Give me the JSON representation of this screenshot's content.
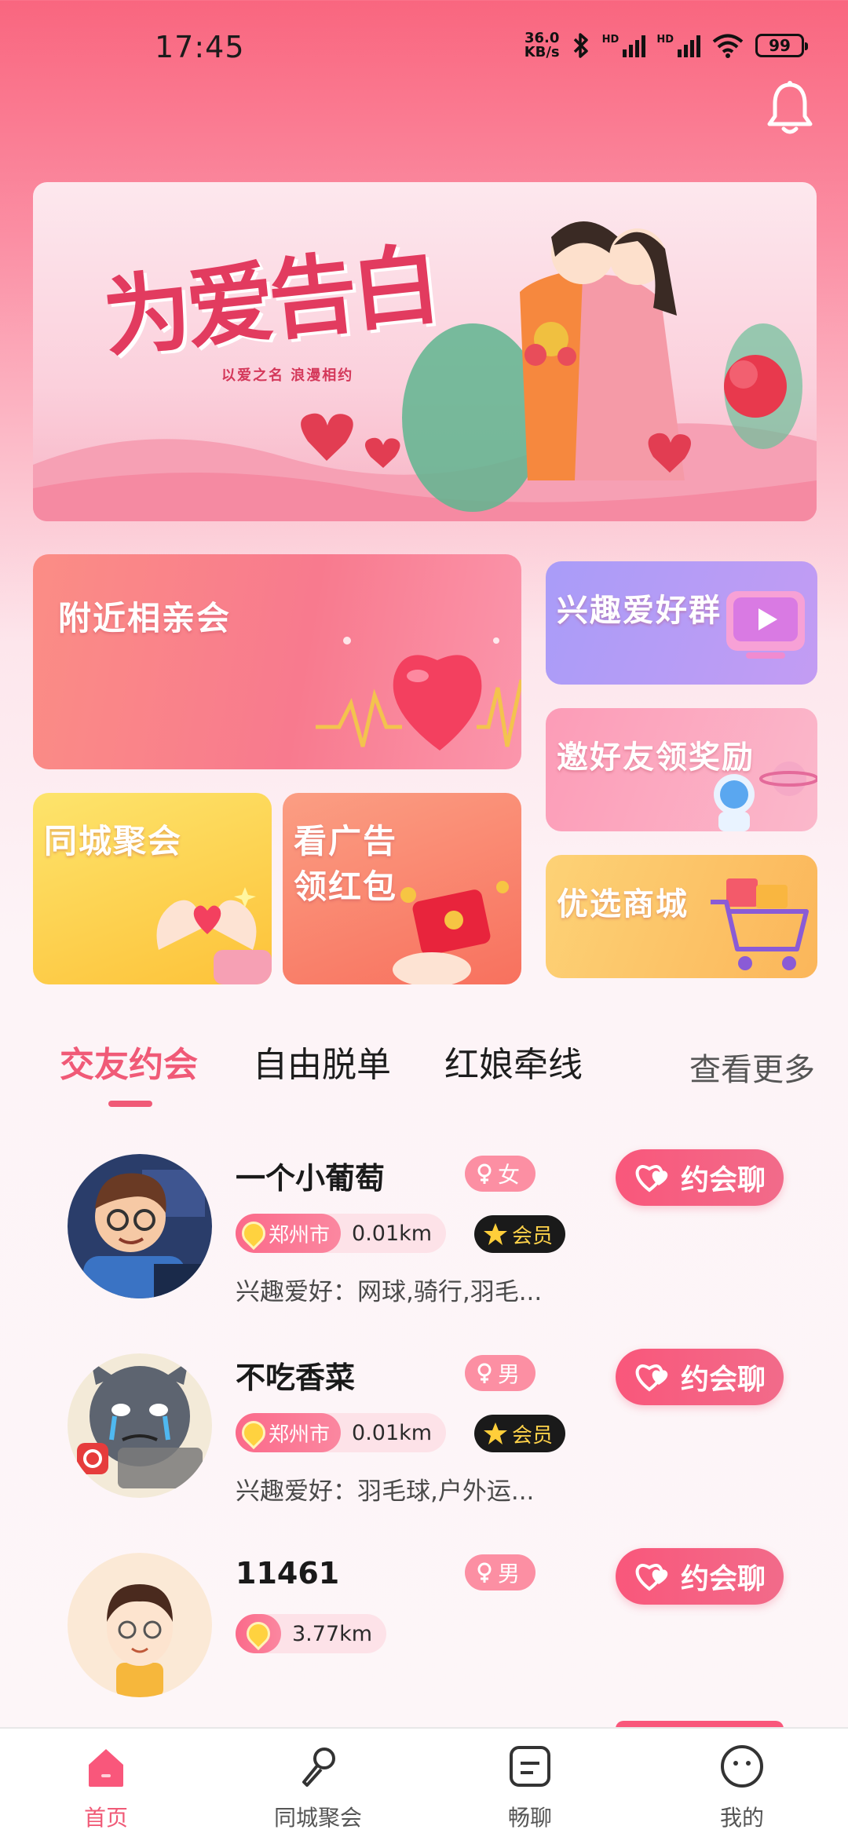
{
  "status": {
    "time": "17:45",
    "net_speed_value": "36.0",
    "net_speed_unit": "KB/s",
    "signal1_label": "HD",
    "signal2_label": "HD",
    "battery": "99"
  },
  "banner": {
    "title": "为爱告白",
    "subtitle": "以爱之名 浪漫相约"
  },
  "features": {
    "nearby": "附近相亲会",
    "hobby_group": "兴趣爱好群",
    "invite": "邀好友领奖励",
    "city_party": "同城聚会",
    "ad_line1": "看广告",
    "ad_line2": "领红包",
    "mall": "优选商城"
  },
  "tabs": [
    {
      "label": "交友约会",
      "active": true
    },
    {
      "label": "自由脱单",
      "active": false
    },
    {
      "label": "红娘牵线",
      "active": false
    }
  ],
  "more_label": "查看更多",
  "date_chat_label": "约会聊",
  "hobby_prefix": "兴趣爱好：",
  "users": [
    {
      "name": "一个小葡萄",
      "gender": "女",
      "city": "郑州市",
      "distance": "0.01km",
      "vip": "会员",
      "hobbies": "网球,骑行,羽毛..."
    },
    {
      "name": "不吃香菜",
      "gender": "男",
      "city": "郑州市",
      "distance": "0.01km",
      "vip": "会员",
      "hobbies": "羽毛球,户外运..."
    },
    {
      "name": "11461",
      "gender": "男",
      "city": "",
      "distance": "3.77km",
      "vip": "",
      "hobbies": ""
    }
  ],
  "nav": [
    {
      "label": "首页",
      "icon": "home-icon",
      "active": true
    },
    {
      "label": "同城聚会",
      "icon": "microphone-icon",
      "active": false
    },
    {
      "label": "畅聊",
      "icon": "chat-icon",
      "active": false
    },
    {
      "label": "我的",
      "icon": "profile-icon",
      "active": false
    }
  ],
  "colors": {
    "accent": "#f05a77",
    "header_pink": "#f9667f",
    "vip_bg": "#1a1a1a",
    "vip_text": "#ffd24a"
  }
}
